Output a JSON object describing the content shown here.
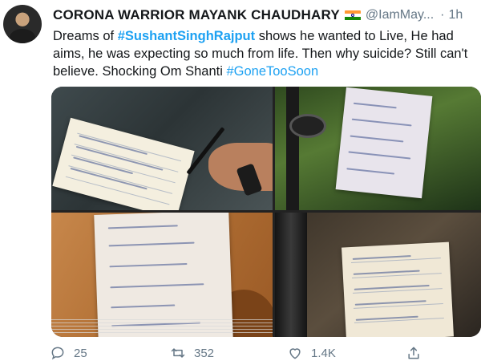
{
  "tweet": {
    "display_name": "CORONA WARRIOR MAYANK CHAUDHARY",
    "handle": "@IamMay...",
    "time": "1h",
    "dot": "·",
    "text_parts": {
      "p1": "Dreams of ",
      "tag1": "#SushantSinghRajput",
      "p2": " shows he wanted to Live, He had aims, he was expecting so much from life. Then why suicide? Still can't believe. Shocking Om Shanti ",
      "tag2": "#GoneTooSoon"
    },
    "flag_icon": "india-flag-icon"
  },
  "actions": {
    "reply_count": "25",
    "retweet_count": "352",
    "like_count": "1.4K"
  },
  "colors": {
    "link": "#1da1f2",
    "muted": "#657786",
    "text": "#14171a"
  }
}
